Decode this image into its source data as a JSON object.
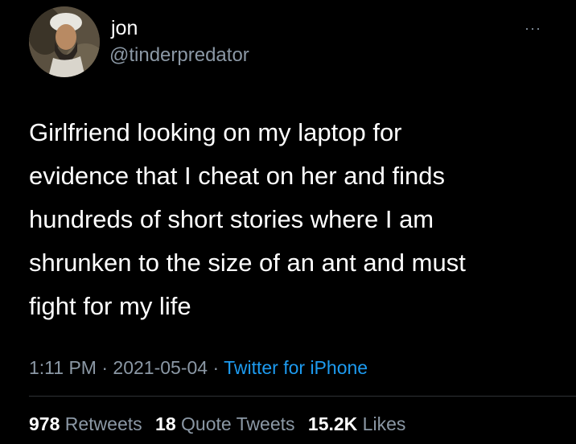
{
  "user": {
    "name": "jon",
    "handle": "@tinderpredator",
    "avatar_icon": "profile-photo"
  },
  "menu": {
    "more_icon": "more-options-icon",
    "glyph": "···"
  },
  "tweet": {
    "text": "Girlfriend looking on my laptop for\nevidence that I cheat on her and finds\nhundreds of short stories where I am\nshrunken to the size of an ant and must\nfight for my life"
  },
  "meta": {
    "time": "1:11 PM",
    "separator": " · ",
    "date": "2021-05-04",
    "source": "Twitter for iPhone"
  },
  "stats": {
    "retweets_count": "978",
    "retweets_label": "Retweets",
    "quotes_count": "18",
    "quotes_label": "Quote Tweets",
    "likes_count": "15.2K",
    "likes_label": "Likes"
  },
  "colors": {
    "background": "#000000",
    "text": "#ffffff",
    "secondary": "#8b98a5",
    "link": "#1d9bf0"
  }
}
